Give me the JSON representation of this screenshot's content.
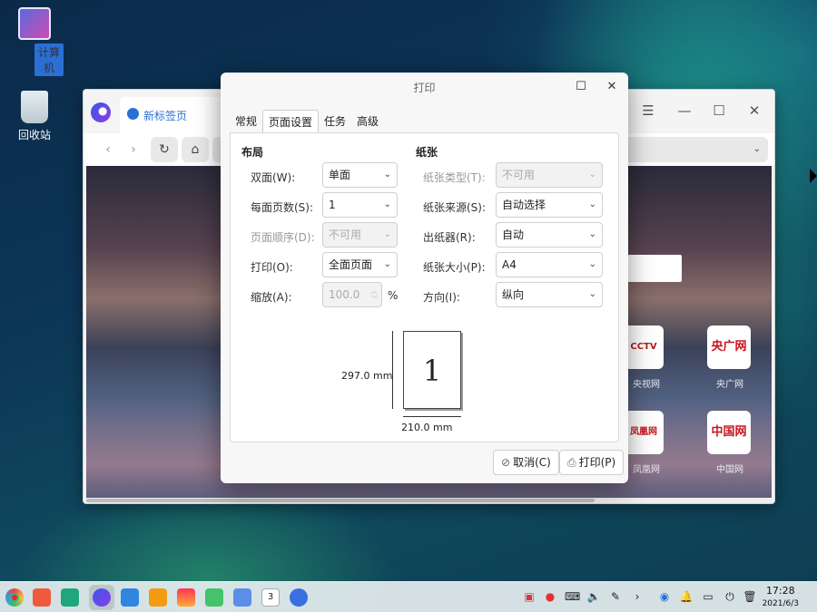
{
  "desktop": {
    "computer_label": "计算机",
    "trash_label": "回收站"
  },
  "browser": {
    "tab_title": "新标签页",
    "min_glyph": "—",
    "max_glyph": "☐",
    "close_glyph": "✕",
    "menu_glyph": "☰",
    "nav_back": "‹",
    "nav_forward": "›",
    "nav_reload": "↻",
    "nav_home": "⌂",
    "sites": [
      {
        "tile": "CCTV",
        "label": "央视网"
      },
      {
        "tile": "央广网",
        "label": "央广网"
      },
      {
        "tile": "凤凰网",
        "label": "凤凰网"
      },
      {
        "tile": "中国网",
        "label": "中国网"
      }
    ]
  },
  "dialog": {
    "title": "打印",
    "tabs": [
      "常规",
      "页面设置",
      "任务",
      "高级"
    ],
    "layout": {
      "heading": "布局",
      "duplex_label": "双面(W):",
      "duplex_value": "单面",
      "pages_per_sheet_label": "每面页数(S):",
      "pages_per_sheet_value": "1",
      "page_order_label": "页面顺序(D):",
      "page_order_value": "不可用",
      "print_label": "打印(O):",
      "print_value": "全面页面",
      "scale_label": "缩放(A):",
      "scale_value": "100.0",
      "scale_unit": "%"
    },
    "paper": {
      "heading": "纸张",
      "type_label": "纸张类型(T):",
      "type_value": "不可用",
      "source_label": "纸张来源(S):",
      "source_value": "自动选择",
      "output_label": "出纸器(R):",
      "output_value": "自动",
      "size_label": "纸张大小(P):",
      "size_value": "A4",
      "orientation_label": "方向(I):",
      "orientation_value": "纵向"
    },
    "preview": {
      "page_number": "1",
      "height_label": "297.0 mm",
      "width_label": "210.0 mm"
    },
    "cancel_label": "取消(C)",
    "print_button_label": "打印(P)"
  },
  "taskbar": {
    "calendar_day": "3",
    "time": "17:28",
    "date": "2021/6/3"
  }
}
